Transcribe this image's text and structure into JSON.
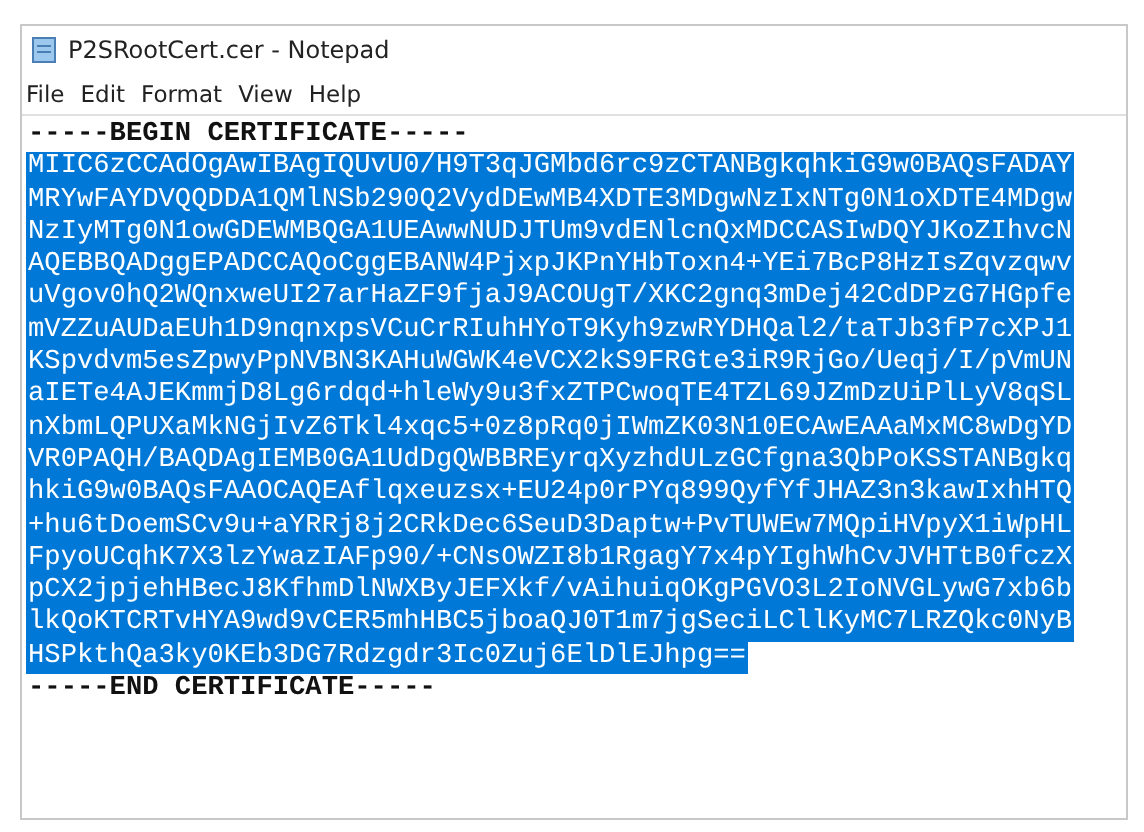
{
  "window": {
    "title": "P2SRootCert.cer - Notepad"
  },
  "menu": [
    "File",
    "Edit",
    "Format",
    "View",
    "Help"
  ],
  "document": {
    "lines": [
      {
        "text": "-----BEGIN CERTIFICATE-----",
        "selected": false
      },
      {
        "text": "MIIC6zCCAdOgAwIBAgIQUvU0/H9T3qJGMbd6rc9zCTANBgkqhkiG9w0BAQsFADAY",
        "selected": true
      },
      {
        "text": "MRYwFAYDVQQDDA1QMlNSb290Q2VydDEwMB4XDTE3MDgwNzIxNTg0N1oXDTE4MDgw",
        "selected": true
      },
      {
        "text": "NzIyMTg0N1owGDEWMBQGA1UEAwwNUDJTUm9vdENlcnQxMDCCASIwDQYJKoZIhvcN",
        "selected": true
      },
      {
        "text": "AQEBBQADggEPADCCAQoCggEBANW4PjxpJKPnYHbToxn4+YEi7BcP8HzIsZqvzqwv",
        "selected": true
      },
      {
        "text": "uVgov0hQ2WQnxweUI27arHaZF9fjaJ9ACOUgT/XKC2gnq3mDej42CdDPzG7HGpfe",
        "selected": true
      },
      {
        "text": "mVZZuAUDaEUh1D9nqnxpsVCuCrRIuhHYoT9Kyh9zwRYDHQal2/taTJb3fP7cXPJ1",
        "selected": true
      },
      {
        "text": "KSpvdvm5esZpwyPpNVBN3KAHuWGWK4eVCX2kS9FRGte3iR9RjGo/Ueqj/I/pVmUN",
        "selected": true
      },
      {
        "text": "aIETe4AJEKmmjD8Lg6rdqd+hleWy9u3fxZTPCwoqTE4TZL69JZmDzUiPlLyV8qSL",
        "selected": true
      },
      {
        "text": "nXbmLQPUXaMkNGjIvZ6Tkl4xqc5+0z8pRq0jIWmZK03N10ECAwEAAaMxMC8wDgYD",
        "selected": true
      },
      {
        "text": "VR0PAQH/BAQDAgIEMB0GA1UdDgQWBBREyrqXyzhdULzGCfgna3QbPoKSSTANBgkq",
        "selected": true
      },
      {
        "text": "hkiG9w0BAQsFAAOCAQEAflqxeuzsx+EU24p0rPYq899QyfYfJHAZ3n3kawIxhHTQ",
        "selected": true
      },
      {
        "text": "+hu6tDoemSCv9u+aYRRj8j2CRkDec6SeuD3Daptw+PvTUWEw7MQpiHVpyX1iWpHL",
        "selected": true
      },
      {
        "text": "FpyoUCqhK7X3lzYwazIAFp90/+CNsOWZI8b1RgagY7x4pYIghWhCvJVHTtB0fczX",
        "selected": true
      },
      {
        "text": "pCX2jpjehHBecJ8KfhmDlNWXByJEFXkf/vAihuiqOKgPGVO3L2IoNVGLywG7xb6b",
        "selected": true
      },
      {
        "text": "lkQoKTCRTvHYA9wd9vCER5mhHBC5jboaQJ0T1m7jgSeciLCllKyMC7LRZQkc0NyB",
        "selected": true
      },
      {
        "text": "HSPkthQa3ky0KEb3DG7Rdzgdr3Ic0Zuj6ElDlEJhpg==",
        "selected": true
      },
      {
        "text": "-----END CERTIFICATE-----",
        "selected": false
      }
    ]
  }
}
